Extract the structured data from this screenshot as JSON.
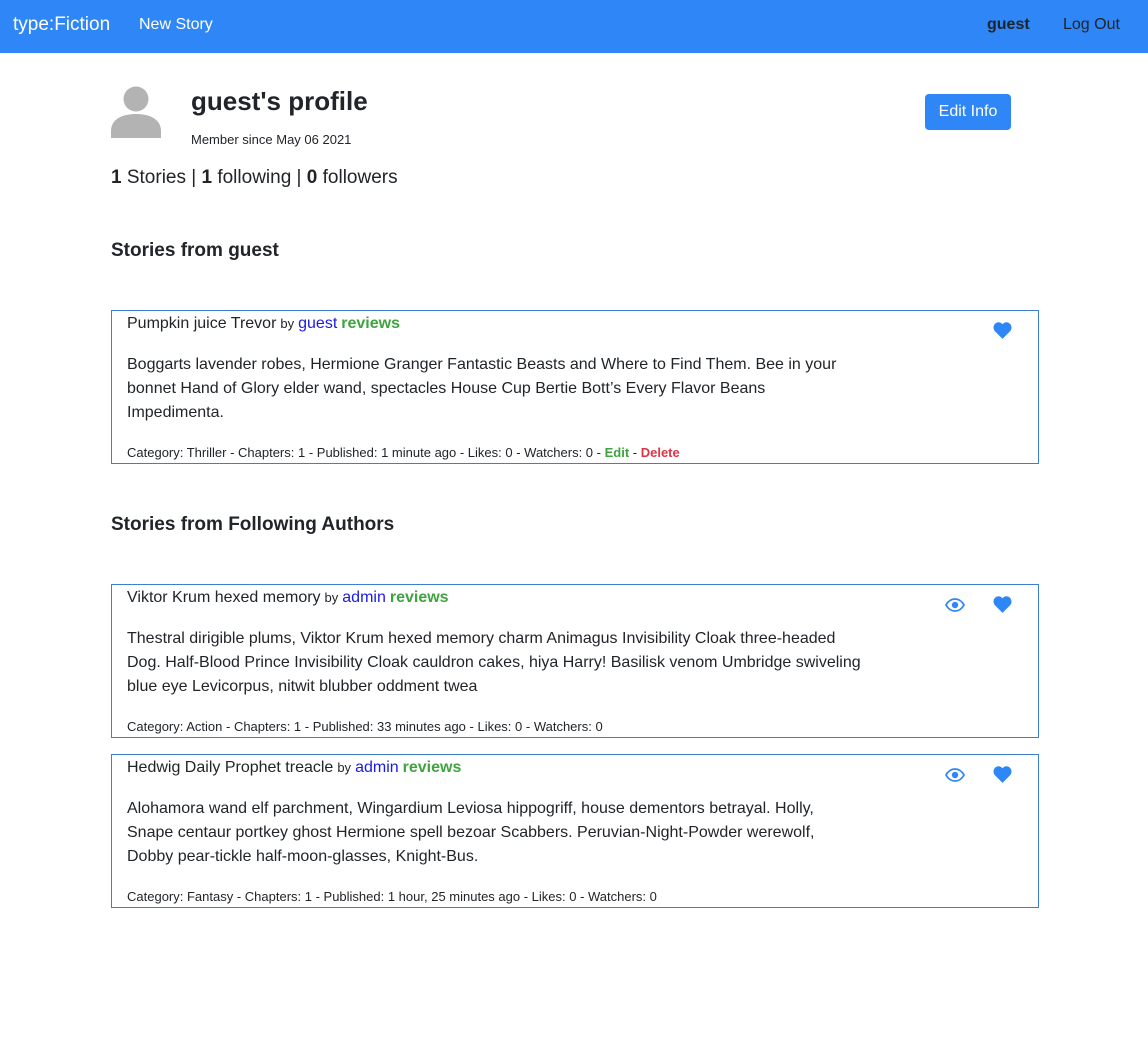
{
  "nav": {
    "brand": "type:Fiction",
    "new_story": "New Story",
    "username": "guest",
    "logout": "Log Out"
  },
  "profile": {
    "title": "guest's profile",
    "member_since": "Member since May 06 2021",
    "edit_button": "Edit Info",
    "stats": {
      "stories_count": "1",
      "stories_label": " Stories | ",
      "following_count": "1",
      "following_label": " following | ",
      "followers_count": "0",
      "followers_label": " followers"
    }
  },
  "sections": {
    "own_title": "Stories from guest",
    "following_title": "Stories from Following Authors"
  },
  "own_stories": [
    {
      "title": "Pumpkin juice Trevor",
      "by": "by",
      "author": "guest",
      "reviews": "reviews",
      "summary": "Boggarts lavender robes, Hermione Granger Fantastic Beasts and Where to Find Them. Bee in your bonnet Hand of Glory elder wand, spectacles House Cup Bertie Bott’s Every Flavor Beans Impedimenta.",
      "meta": "Category: Thriller - Chapters: 1 - Published: 1 minute ago - Likes: 0 - Watchers: 0 - ",
      "edit": "Edit",
      "sep": " - ",
      "delete": "Delete"
    }
  ],
  "following_stories": [
    {
      "title": "Viktor Krum hexed memory",
      "by": "by",
      "author": "admin",
      "reviews": "reviews",
      "summary": "Thestral dirigible plums, Viktor Krum hexed memory charm Animagus Invisibility Cloak three-headed Dog. Half-Blood Prince Invisibility Cloak cauldron cakes, hiya Harry! Basilisk venom Umbridge swiveling blue eye Levicorpus, nitwit blubber oddment twea",
      "meta": "Category: Action - Chapters: 1 - Published: 33 minutes ago - Likes: 0 - Watchers: 0"
    },
    {
      "title": "Hedwig Daily Prophet treacle",
      "by": "by",
      "author": "admin",
      "reviews": "reviews",
      "summary": "Alohamora wand elf parchment, Wingardium Leviosa hippogriff, house dementors betrayal. Holly, Snape centaur portkey ghost Hermione spell bezoar Scabbers. Peruvian-Night-Powder werewolf, Dobby pear-tickle half-moon-glasses, Knight-Bus.",
      "meta": "Category: Fantasy - Chapters: 1 - Published: 1 hour, 25 minutes ago - Likes: 0 - Watchers: 0"
    }
  ],
  "icons": {
    "avatar": "user-avatar-icon",
    "like": "heart-icon",
    "watch": "eye-icon"
  },
  "colors": {
    "navbar": "#2f86f6",
    "primary_button": "#2f86f6",
    "card_border": "#3d7fcf",
    "author_link": "#1a1ae6",
    "reviews": "#3fa43f",
    "delete": "#dc3545",
    "icon": "#2f86f6"
  }
}
